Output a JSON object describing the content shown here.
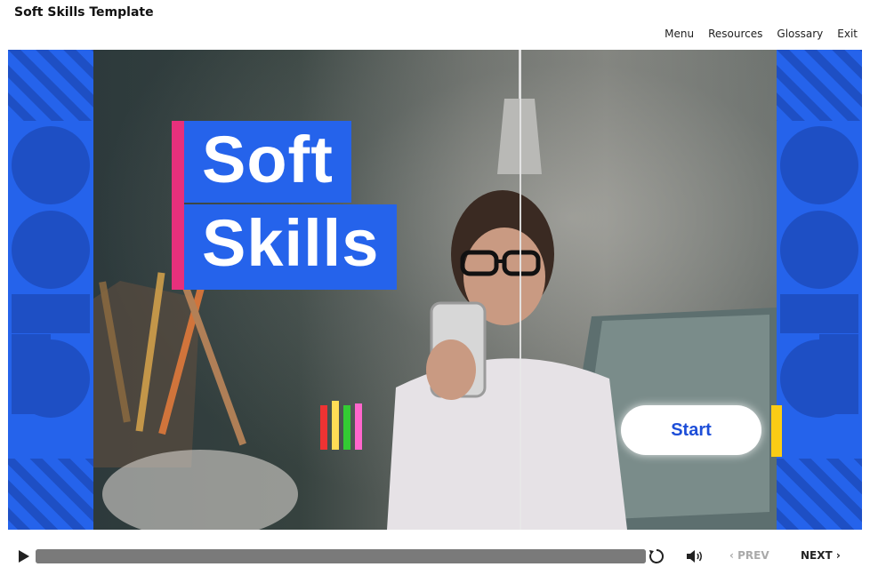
{
  "window": {
    "title": "Soft Skills Template"
  },
  "top_menu": {
    "items": [
      "Menu",
      "Resources",
      "Glossary",
      "Exit"
    ]
  },
  "slide": {
    "title_line1": "Soft",
    "title_line2": "Skills",
    "start_label": "Start"
  },
  "player": {
    "prev_label": "PREV",
    "next_label": "NEXT",
    "progress_percent": 100,
    "prev_enabled": false
  },
  "colors": {
    "accent_blue": "#2563eb",
    "pink": "#e6307c",
    "yellow": "#facc15",
    "progress_gray": "#7a7a7a"
  },
  "icons": {
    "play": "play-icon",
    "replay": "replay-icon",
    "volume": "volume-icon",
    "prev": "chevron-left-icon",
    "next": "chevron-right-icon"
  }
}
